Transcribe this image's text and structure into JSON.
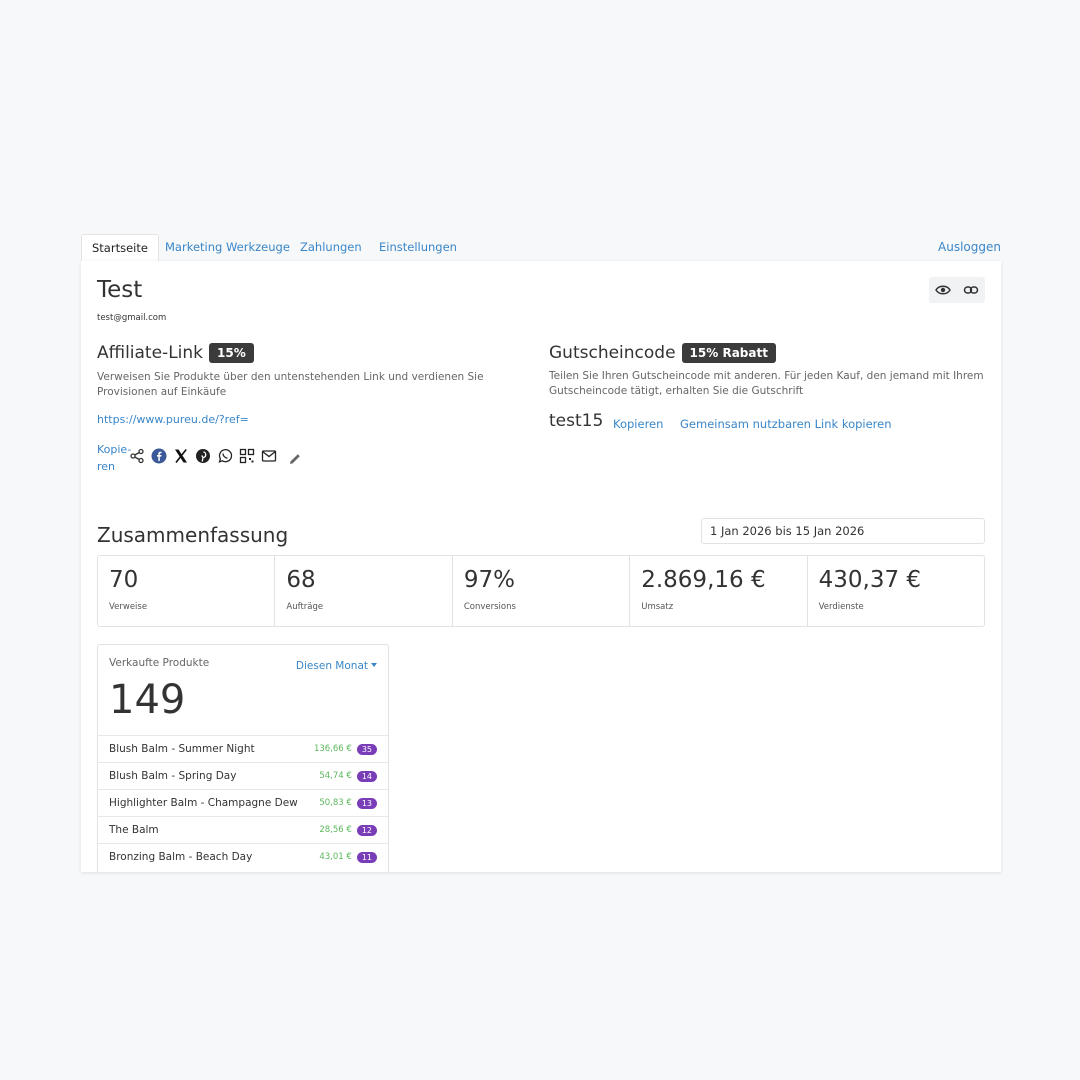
{
  "tabs": [
    "Startseite",
    "Marketing Werkzeuge",
    "Zahlungen",
    "Einstellungen"
  ],
  "logout_label": "Ausloggen",
  "profile": {
    "name": "Test",
    "email": "test@gmail.com"
  },
  "affiliate": {
    "title": "Affiliate-Link",
    "badge": "15%",
    "description": "Verweisen Sie Produkte über den untenstehenden Link und verdienen Sie Provisionen auf Einkäufe",
    "url": "https://www.pureu.de/?ref=",
    "copy_label_1": "Kopie-",
    "copy_label_2": "ren"
  },
  "coupon": {
    "title": "Gutscheincode",
    "badge": "15% Rabatt",
    "description": "Teilen Sie Ihren Gutscheincode mit anderen. Für jeden Kauf, den jemand mit Ihrem Gutscheincode tätigt, erhalten Sie die Gutschrift",
    "code": "test15",
    "copy_label": "Kopieren",
    "share_link_label": "Gemeinsam nutzbaren Link kopieren"
  },
  "summary": {
    "title": "Zusammenfassung",
    "date_range": "1 Jan 2026 bis 15 Jan 2026",
    "stats": [
      {
        "value": "70",
        "label": "Verweise"
      },
      {
        "value": "68",
        "label": "Aufträge"
      },
      {
        "value": "97%",
        "label": "Conversions"
      },
      {
        "value": "2.869,16 €",
        "label": "Umsatz"
      },
      {
        "value": "430,37 €",
        "label": "Verdienste"
      }
    ]
  },
  "products": {
    "title": "Verkaufte Produkte",
    "filter": "Diesen Monat",
    "count": "149",
    "items": [
      {
        "name": "Blush Balm - Summer Night",
        "price": "136,66 €",
        "qty": "35"
      },
      {
        "name": "Blush Balm - Spring Day",
        "price": "54,74 €",
        "qty": "14"
      },
      {
        "name": "Highlighter Balm - Champagne Dew",
        "price": "50,83 €",
        "qty": "13"
      },
      {
        "name": "The Balm",
        "price": "28,56 €",
        "qty": "12"
      },
      {
        "name": "Bronzing Balm - Beach Day",
        "price": "43,01 €",
        "qty": "11"
      }
    ]
  },
  "icons": {
    "view": "eye-icon",
    "link": "link-icon",
    "share": [
      "share-icon",
      "facebook-icon",
      "x-icon",
      "pinterest-icon",
      "whatsapp-icon",
      "qr-code-icon",
      "mail-icon",
      "pencil-icon"
    ]
  },
  "colors": {
    "accent": "#3a86c8",
    "badge": "#3b3b3b",
    "price": "#5cb85c",
    "qty_badge": "#7a3db8"
  }
}
